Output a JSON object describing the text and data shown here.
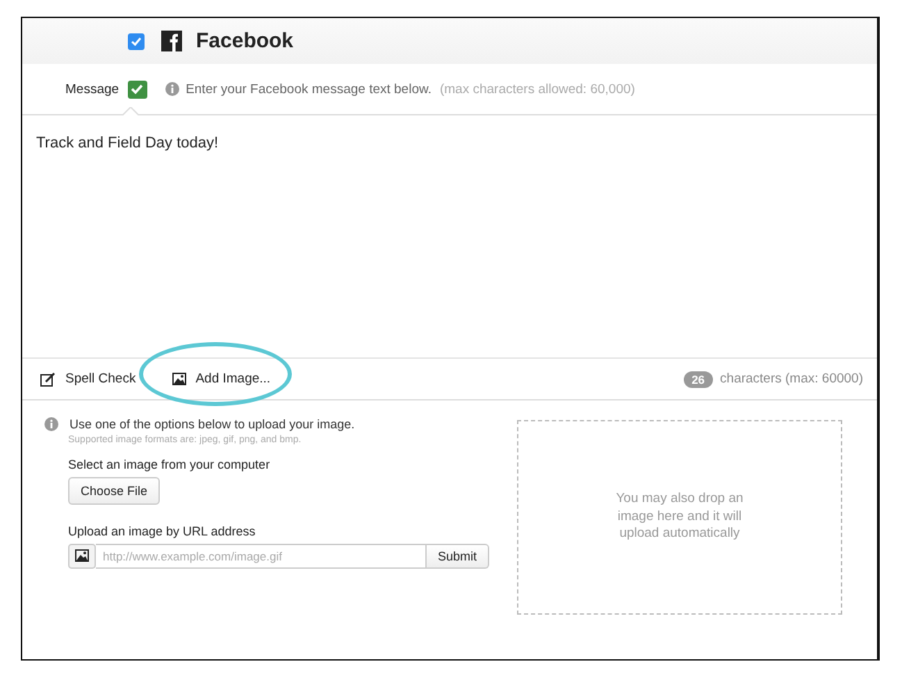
{
  "platform": {
    "name": "Facebook",
    "checked": true
  },
  "message": {
    "label": "Message",
    "checked": true,
    "hint": "Enter your Facebook message text below.",
    "limit_note": "(max characters allowed: 60,000)",
    "value": "Track and Field Day today!"
  },
  "toolbar": {
    "spell_check": "Spell Check",
    "add_image": "Add Image...",
    "add_image_highlighted": true,
    "count": "26",
    "count_label": "characters (max: 60000)"
  },
  "upload": {
    "intro": "Use one of the options below to upload your image.",
    "formats": "Supported image formats are: jpeg, gif, png, and bmp.",
    "computer_label": "Select an image from your computer",
    "choose_button": "Choose File",
    "url_label": "Upload an image by URL address",
    "url_placeholder": "http://www.example.com/image.gif",
    "submit_button": "Submit",
    "drop_text": "You may also drop an image here and it will upload automatically"
  }
}
